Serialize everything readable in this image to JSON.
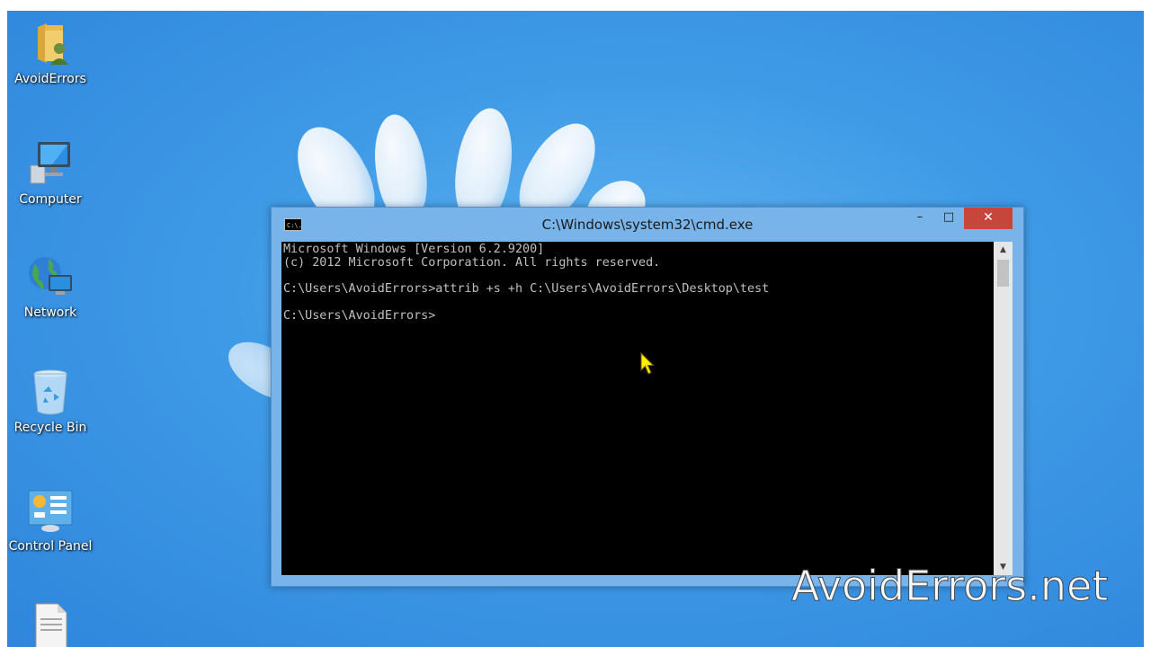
{
  "desktop": {
    "icons": [
      {
        "label": "AvoidErrors",
        "icon": "user-folder-icon"
      },
      {
        "label": "Computer",
        "icon": "computer-icon"
      },
      {
        "label": "Network",
        "icon": "network-icon"
      },
      {
        "label": "Recycle Bin",
        "icon": "recycle-bin-icon"
      },
      {
        "label": "Control Panel",
        "icon": "control-panel-icon"
      },
      {
        "label": "",
        "icon": "text-file-icon"
      }
    ]
  },
  "cmd": {
    "title": "C:\\Windows\\system32\\cmd.exe",
    "title_icon_text": "C:\\.",
    "minimize_label": "–",
    "maximize_label": "□",
    "close_label": "✕",
    "console_output": "Microsoft Windows [Version 6.2.9200]\n(c) 2012 Microsoft Corporation. All rights reserved.\n\nC:\\Users\\AvoidErrors>attrib +s +h C:\\Users\\AvoidErrors\\Desktop\\test\n\nC:\\Users\\AvoidErrors>",
    "scroll_up_label": "▲",
    "scroll_down_label": "▼",
    "colors": {
      "console_bg": "#000000",
      "console_fg": "#c0c0c0",
      "frame": "#78b4ea",
      "close_button": "#c7463c"
    }
  },
  "watermark": {
    "text": "AvoidErrors.net"
  },
  "cursor": {
    "color": "#ffee00",
    "icon": "mouse-pointer-icon"
  }
}
